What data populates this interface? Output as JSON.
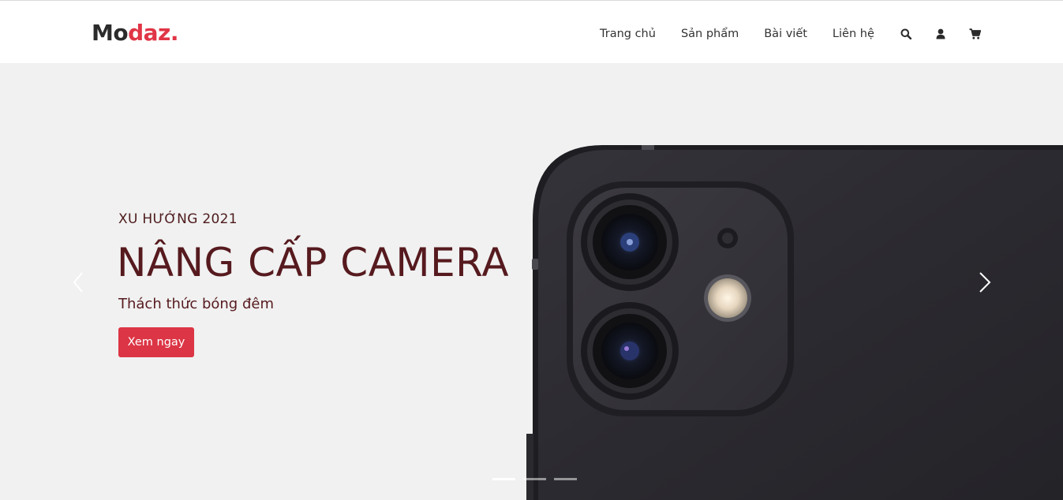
{
  "brand": {
    "part1": "Mo",
    "part2": "daz.",
    "color_dark": "#2b2b2b",
    "color_accent": "#e03546"
  },
  "nav": {
    "links": [
      "Trang chủ",
      "Sản phẩm",
      "Bài viết",
      "Liên hệ"
    ],
    "icons": [
      "search-icon",
      "user-icon",
      "cart-icon"
    ]
  },
  "hero": {
    "kicker": "XU HƯỚNG 2021",
    "headline": "NÂNG CẤP CAMERA",
    "subline": "Thách thức bóng đêm",
    "cta_label": "Xem ngay",
    "cta_color": "#dc3545",
    "text_color": "#561a1e",
    "background": "#f1f1f1",
    "slide_count": 3,
    "active_slide": 1
  }
}
